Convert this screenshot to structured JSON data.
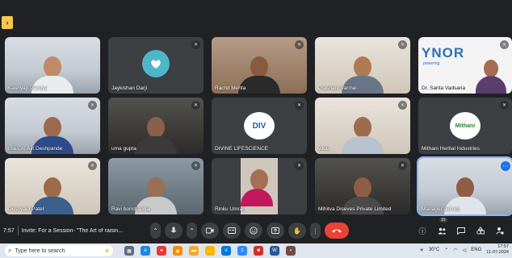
{
  "participants": [
    {
      "name": "Kashyap Pandya",
      "muted": false
    },
    {
      "name": "Jaykishan Darji",
      "muted": true
    },
    {
      "name": "Rachit Mehta",
      "muted": true
    },
    {
      "name": "Prashant Varma",
      "muted": true
    },
    {
      "name": "Dr. Sarita Vadsaria",
      "muted": true,
      "logo_text": "YNOR",
      "logo_sub": "powering"
    },
    {
      "name": "rises.AI Ajit Deshpande",
      "muted": true
    },
    {
      "name": "uma gupta",
      "muted": true
    },
    {
      "name": "DIVINE LIFESCIENCE",
      "muted": true,
      "logo_text": "DIV"
    },
    {
      "name": "vikas",
      "muted": true
    },
    {
      "name": "Mithani Herbal Industries",
      "muted": true,
      "logo_text": "Mithani"
    },
    {
      "name": "Dushyant Patel",
      "muted": true
    },
    {
      "name": "Ravi borichangar",
      "muted": true
    },
    {
      "name": "Rinku Umrani",
      "muted": true
    },
    {
      "name": "Mihitva Diseves Private Limited",
      "muted": true
    },
    {
      "name": "Manager aicmcp",
      "muted": false,
      "active": true
    }
  ],
  "meeting_bar": {
    "time": "7:57",
    "title": "Invite: For a Session- \"The Art of raisin...",
    "people_count": "15"
  },
  "taskbar": {
    "search_placeholder": "Type here to search",
    "weather": "30°C",
    "language": "EN",
    "language_code": "ENG",
    "clock_time": "17:57",
    "clock_date": "11-07-2024"
  },
  "colors": {
    "meet_bg": "#202124",
    "tile_bg": "#3c4043",
    "end_call": "#ea4335",
    "active_outline": "#8ab4f8"
  }
}
